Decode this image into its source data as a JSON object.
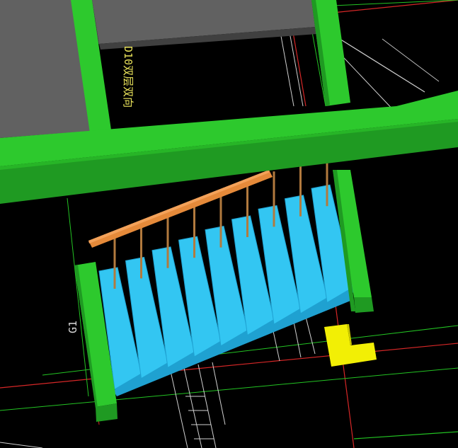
{
  "viewport": {
    "background": "#000000"
  },
  "labels": {
    "rebar_note": "D10双层双向",
    "axis_mark": "G1"
  },
  "colors": {
    "beam_green": "#2dc92d",
    "beam_green_dark": "#1f9a22",
    "slab_gray": "#616161",
    "stair_blue": "#33c6f2",
    "stair_blue_dark": "#1fa1d1",
    "handrail_orange": "#e58a3a",
    "baluster": "#b27a3e",
    "cad_red": "#d62727",
    "cad_green": "#23c423",
    "cad_white": "#d8d8d8",
    "corner_yellow": "#f2ef05"
  },
  "stair": {
    "step_count": 9,
    "baluster_count": 9
  }
}
